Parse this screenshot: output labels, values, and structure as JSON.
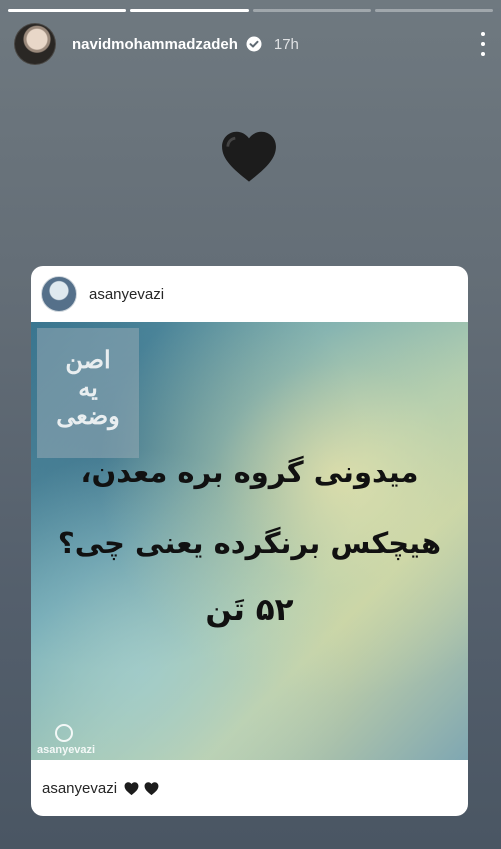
{
  "story": {
    "progress_segments": 4,
    "active_index": 1
  },
  "header": {
    "username": "navidmohammadzadeh",
    "time": "17h",
    "verified": true
  },
  "sticker": {
    "emoji_name": "black-heart-icon"
  },
  "post": {
    "username": "asanyevazi",
    "logo_text": "اصن\nیه\nوضعی",
    "quote_lines": [
      "میدونی گروه بره معدن،",
      "هیچکس برنگرده یعنی چی؟",
      "۵۲ تَن"
    ],
    "watermark": "asanyevazi",
    "caption_user": "asanyevazi"
  },
  "colors": {
    "accent": "#ffffff",
    "card_bg": "#ffffff",
    "heart": "#1a1a1a"
  }
}
